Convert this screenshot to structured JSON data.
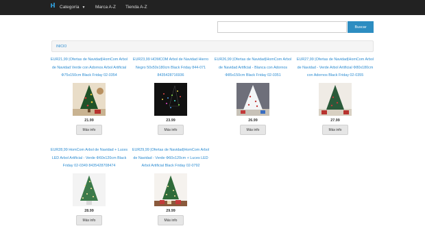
{
  "nav": {
    "categoria_label": "Categoría",
    "marca_label": "Marca A-Z",
    "tienda_label": "Tienda A-Z"
  },
  "search": {
    "button_label": "Buscar",
    "placeholder": ""
  },
  "breadcrumb": {
    "home_label": "INICIO"
  },
  "products": [
    {
      "title": "EUR21,99 |Ofertas de Navidad|HomCom Arbol de Navidad Verde con Adornos Arbol Artificial Φ75x150cm Black Friday 02-0354 8435428708436",
      "price": "21.99",
      "button_label": "Más info"
    },
    {
      "title": "EUR23,99 HOMCOM Arbol de Navidad Hierro Negro 50x50x180cm Black Friday 844-071 8435428716936",
      "price": "23.99",
      "button_label": "Más info"
    },
    {
      "title": "EUR26,99 |Ofertas de Navidad|HomCom Arbol de Navidad Artificial - Blanca con Adornos Φ85x150cm Black Friday 02-0351 8435428708498",
      "price": "26.99",
      "button_label": "Más info"
    },
    {
      "title": "EUR27,99 |Ofertas de Navidad|HomCom Arbol de Navidad - Verde Arbol Artificial Φ80x180cm con Adornos Black Friday 02-0355 8435428702250",
      "price": "27.99",
      "button_label": "Más info"
    },
    {
      "title": "EUR28,99 HomCom Arbol de Navidad + Luces LED Arbol Artificial - Verde Φ60x120cm Black Friday 02-0349 8435428708474",
      "price": "28.99",
      "button_label": "Más info"
    },
    {
      "title": "EUR29,99 |Ofertas de Navidad|HomCom Arbol de Navidad - Verde Φ60x120cm + Luces LED Arbol Artificial Black Friday 02-0792 8435428709075",
      "price": "29.99",
      "button_label": "Más info"
    }
  ],
  "colors": {
    "navbar": "#222222",
    "accent": "#2d8dc1",
    "link": "#2a8bd1"
  }
}
